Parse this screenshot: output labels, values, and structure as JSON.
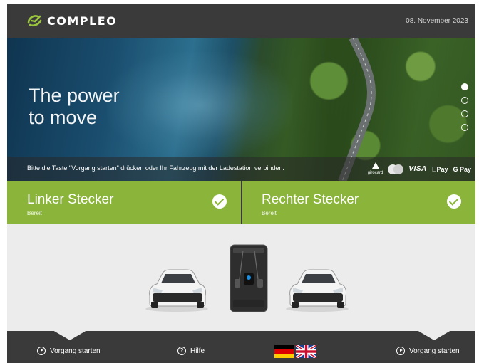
{
  "header": {
    "brand": "COMPLEO",
    "date": "08. November 2023"
  },
  "hero": {
    "tagline_line1": "The power",
    "tagline_line2": "to move",
    "instruction": "Bitte die Taste \"Vorgang starten\" drücken oder Ihr Fahrzeug mit der Ladestation verbinden.",
    "carousel_total": 4,
    "carousel_active_index": 0,
    "payment": {
      "girocard": "girocard",
      "visa": "VISA",
      "apple_pay": "Pay",
      "google_pay": "G Pay"
    }
  },
  "connectors": [
    {
      "title": "Linker Stecker",
      "status": "Bereit"
    },
    {
      "title": "Rechter Stecker",
      "status": "Bereit"
    }
  ],
  "footer": {
    "start_left": "Vorgang starten",
    "help": "Hilfe",
    "start_right": "Vorgang starten",
    "languages": [
      "de",
      "en"
    ]
  },
  "colors": {
    "accent_green": "#8bb53a",
    "dark_bg": "#3a3a3a",
    "stage_bg": "#ececec"
  }
}
